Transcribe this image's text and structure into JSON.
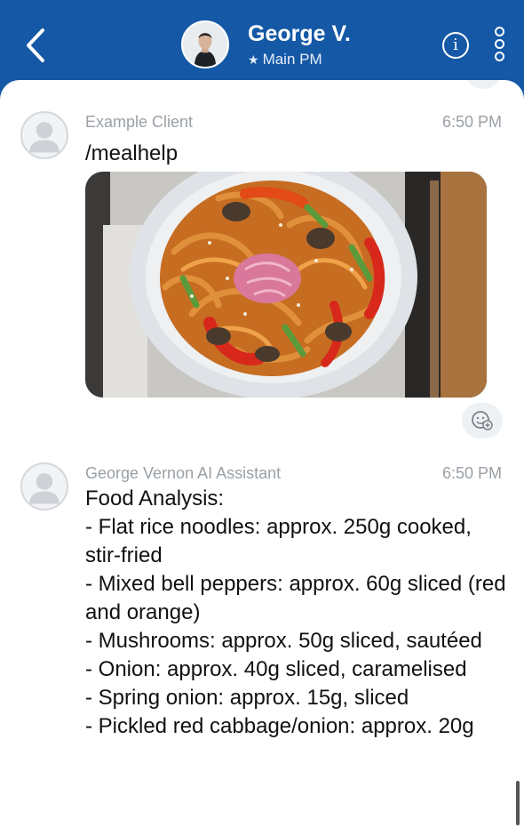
{
  "header": {
    "contact_name": "George V.",
    "subtitle_star": "★",
    "subtitle": "Main PM",
    "info_glyph": "i",
    "back_icon": "chevron-left-icon",
    "more_icon": "vertical-dots-icon"
  },
  "messages": [
    {
      "sender": "Example Client",
      "time": "6:50 PM",
      "text": "/mealhelp",
      "image": "stir-fried noodles dish",
      "reaction_icon": "add-reaction-icon"
    },
    {
      "sender": "George Vernon AI Assistant",
      "time": "6:50 PM",
      "lines": [
        "Food Analysis:",
        "- Flat rice noodles: approx. 250g cooked, stir-fried",
        "- Mixed bell peppers: approx. 60g sliced (red and orange)",
        "- Mushrooms: approx. 50g sliced, sautéed",
        "- Onion: approx. 40g sliced, caramelised",
        "- Spring onion: approx. 15g, sliced",
        "- Pickled red cabbage/onion: approx. 20g"
      ]
    }
  ],
  "colors": {
    "header_bg": "#1458a6",
    "panel_bg": "#ffffff",
    "meta_text": "#9aa0a6",
    "body_text": "#111111"
  }
}
